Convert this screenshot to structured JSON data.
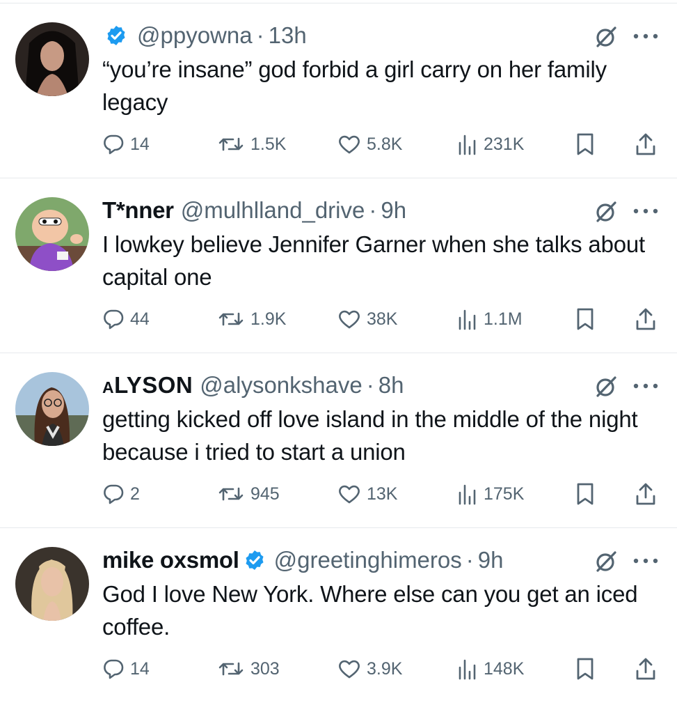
{
  "colors": {
    "verified": "#1d9bf0",
    "secondary_text": "#536471",
    "primary_text": "#0f1419",
    "divider": "#e6e9ec"
  },
  "tweets": [
    {
      "name": "",
      "verified_before_handle": true,
      "handle": "@ppyowna",
      "time": "13h",
      "text": "“you’re insane” god forbid a girl carry on her family legacy",
      "replies": "14",
      "retweets": "1.5K",
      "likes": "5.8K",
      "views": "231K"
    },
    {
      "name": "T*nner",
      "handle": "@mulhlland_drive",
      "time": "9h",
      "text": "I lowkey believe Jennifer Garner when she talks about capital one",
      "replies": "44",
      "retweets": "1.9K",
      "likes": "38K",
      "views": "1.1M"
    },
    {
      "name": "aLYSON",
      "handle": "@alysonkshave",
      "time": "8h",
      "text": "getting kicked off love island in the middle of the night because i tried to start a union",
      "replies": "2",
      "retweets": "945",
      "likes": "13K",
      "views": "175K"
    },
    {
      "name": "mike oxsmol",
      "verified_after_name": true,
      "handle": "@greetinghimeros",
      "time": "9h",
      "text": "God I love New York. Where else can you get an iced coffee.",
      "replies": "14",
      "retweets": "303",
      "likes": "3.9K",
      "views": "148K"
    }
  ],
  "separator": "·",
  "icons": [
    "verified-badge-icon",
    "grok-icon",
    "more-icon",
    "reply-icon",
    "retweet-icon",
    "like-icon",
    "views-icon",
    "bookmark-icon",
    "share-icon"
  ]
}
